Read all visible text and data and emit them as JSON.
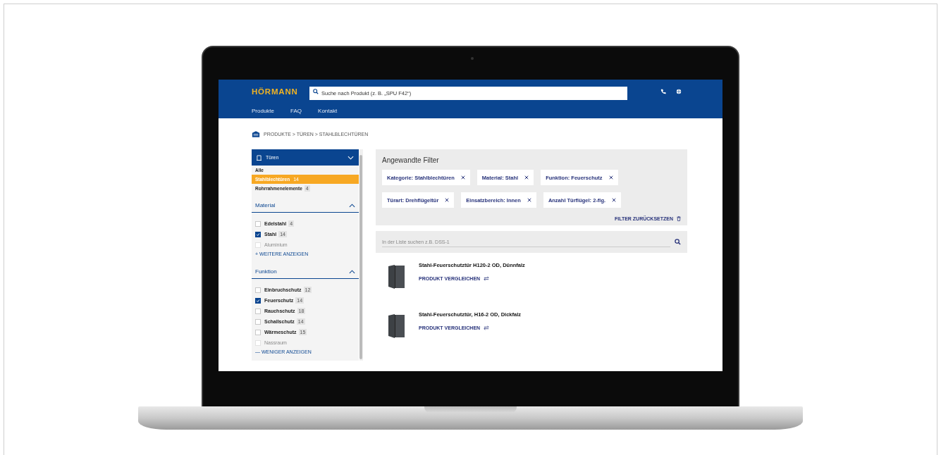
{
  "header": {
    "logo": "HÖRMANN",
    "search": {
      "placeholder": "Suche nach Produkt (z. B. „SPU F42“)"
    },
    "nav": [
      "Produkte",
      "FAQ",
      "Kontakt"
    ]
  },
  "breadcrumb": "PRODUKTE > TÜREN > STAHLBLECHTÜREN",
  "sidebar": {
    "category": {
      "title": "Türen",
      "items": [
        {
          "label": "Alle",
          "selected": false
        },
        {
          "label": "Stahlblechtüren",
          "count": "14",
          "selected": true
        },
        {
          "label": "Rohrrahmenelemente",
          "count": "4",
          "selected": false
        }
      ]
    },
    "sections": [
      {
        "title": "Material",
        "items": [
          {
            "label": "Edelstahl",
            "count": "4",
            "checked": false,
            "disabled": false
          },
          {
            "label": "Stahl",
            "count": "14",
            "checked": true,
            "disabled": false
          },
          {
            "label": "Aluminium",
            "checked": false,
            "disabled": true
          }
        ],
        "more": "+ WEITERE ANZEIGEN"
      },
      {
        "title": "Funktion",
        "items": [
          {
            "label": "Einbruchschutz",
            "count": "12",
            "checked": false,
            "disabled": false
          },
          {
            "label": "Feuerschutz",
            "count": "14",
            "checked": true,
            "disabled": false
          },
          {
            "label": "Rauchschutz",
            "count": "18",
            "checked": false,
            "disabled": false
          },
          {
            "label": "Schallschutz",
            "count": "14",
            "checked": false,
            "disabled": false
          },
          {
            "label": "Wärmeschutz",
            "count": "15",
            "checked": false,
            "disabled": false
          },
          {
            "label": "Nassraum",
            "checked": false,
            "disabled": true
          }
        ],
        "more": "— WENIGER ANZEIGEN"
      }
    ]
  },
  "filters": {
    "title": "Angewandte Filter",
    "chips": [
      "Kategorie: Stahlblechtüren",
      "Material: Stahl",
      "Funktion: Feuerschutz",
      "Türart: Drehflügeltür",
      "Einsatzbereich: Innen",
      "Anzahl Türflügel: 2-flg."
    ],
    "reset": "FILTER ZURÜCKSETZEN"
  },
  "list_search": {
    "placeholder": "In der Liste suchen z.B. DSS-1"
  },
  "products": [
    {
      "name": "Stahl-Feuerschutztür H120-2 OD, Dünnfalz",
      "compare": "PRODUKT VERGLEICHEN"
    },
    {
      "name": "Stahl-Feuerschutztür, H16-2 OD, Dickfalz",
      "compare": "PRODUKT VERGLEICHEN"
    }
  ]
}
